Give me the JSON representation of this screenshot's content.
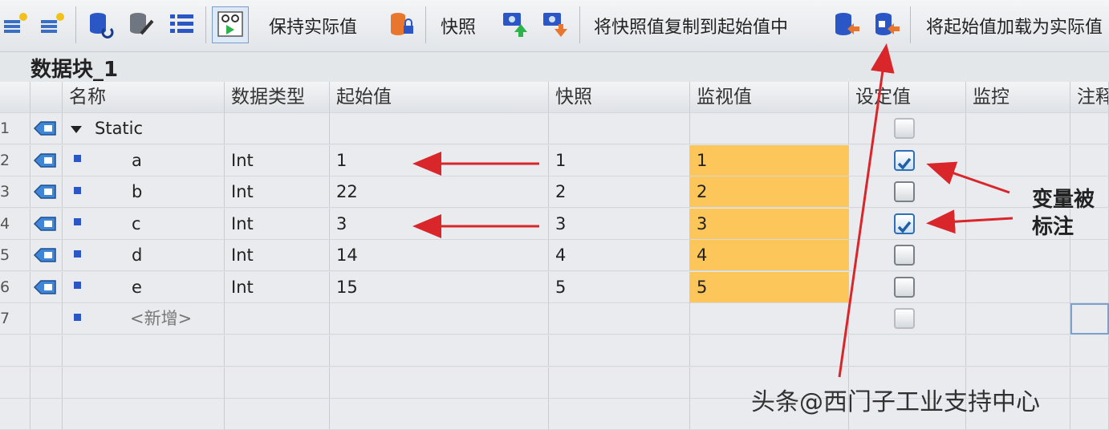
{
  "toolbar": {
    "keep_actual_label": "保持实际值",
    "snapshot_label": "快照",
    "copy_snapshot_label": "将快照值复制到起始值中",
    "load_start_label": "将起始值加载为实际值"
  },
  "block_title": "数据块_1",
  "columns": {
    "name": "名称",
    "datatype": "数据类型",
    "start_value": "起始值",
    "snapshot": "快照",
    "monitor_value": "监视值",
    "setpoint": "设定值",
    "supervision": "监控",
    "comment": "注释"
  },
  "rows": [
    {
      "num": "1",
      "name": "Static",
      "type": "",
      "start": "",
      "snapshot": "",
      "monitor": "",
      "setpoint": false
    },
    {
      "num": "2",
      "name": "a",
      "type": "Int",
      "start": "1",
      "snapshot": "1",
      "monitor": "1",
      "setpoint": true
    },
    {
      "num": "3",
      "name": "b",
      "type": "Int",
      "start": "22",
      "snapshot": "2",
      "monitor": "2",
      "setpoint": false
    },
    {
      "num": "4",
      "name": "c",
      "type": "Int",
      "start": "3",
      "snapshot": "3",
      "monitor": "3",
      "setpoint": true
    },
    {
      "num": "5",
      "name": "d",
      "type": "Int",
      "start": "14",
      "snapshot": "4",
      "monitor": "4",
      "setpoint": false
    },
    {
      "num": "6",
      "name": "e",
      "type": "Int",
      "start": "15",
      "snapshot": "5",
      "monitor": "5",
      "setpoint": false
    },
    {
      "num": "7",
      "name": "<新增>",
      "type": "",
      "start": "",
      "snapshot": "",
      "monitor": "",
      "setpoint": false
    }
  ],
  "annotation": {
    "line1": "变量被",
    "line2": "标注"
  },
  "watermark": "头条@西门子工业支持中心",
  "colors": {
    "monitor_fill": "#fcc65b",
    "arrow": "#d9262b",
    "check_accent": "#2f6fb3"
  }
}
